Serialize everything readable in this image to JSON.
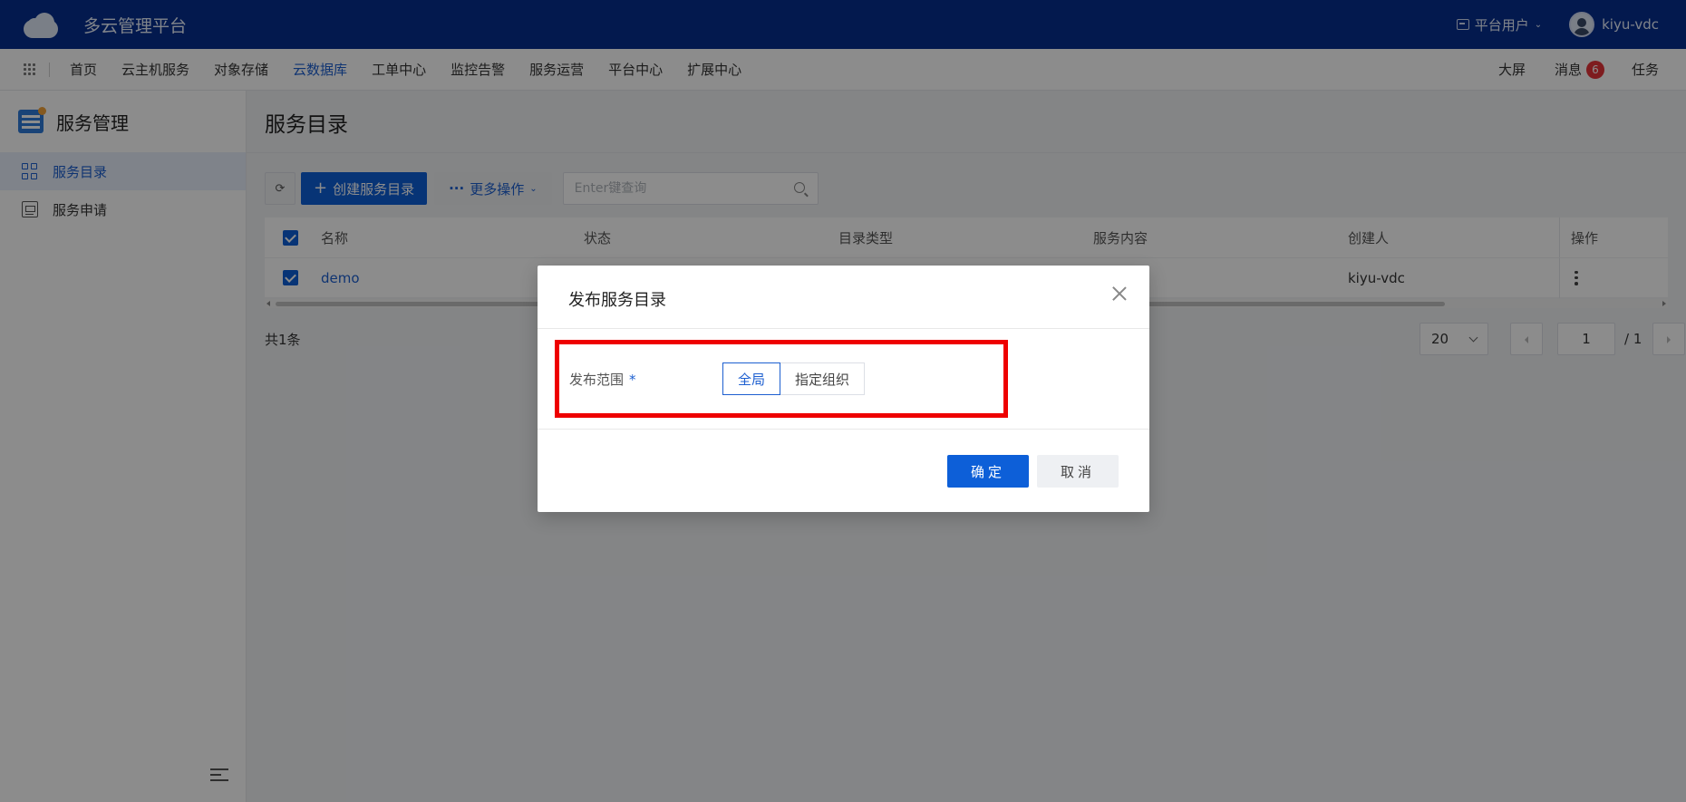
{
  "app": {
    "title": "多云管理平台"
  },
  "topbar": {
    "role": "平台用户",
    "username": "kiyu-vdc"
  },
  "nav": {
    "items": [
      "首页",
      "云主机服务",
      "对象存储",
      "云数据库",
      "工单中心",
      "监控告警",
      "服务运营",
      "平台中心",
      "扩展中心"
    ],
    "active_index": 3,
    "right": {
      "screen": "大屏",
      "messages": "消息",
      "message_count": "6",
      "tasks": "任务"
    }
  },
  "sidebar": {
    "title": "服务管理",
    "items": [
      {
        "label": "服务目录",
        "active": true
      },
      {
        "label": "服务申请",
        "active": false
      }
    ]
  },
  "main": {
    "page_title": "服务目录",
    "toolbar": {
      "refresh_icon": "refresh-icon",
      "create_label": "创建服务目录",
      "more_label": "更多操作",
      "search_placeholder": "Enter键查询"
    },
    "table": {
      "columns": [
        "名称",
        "状态",
        "目录类型",
        "服务内容",
        "创建人",
        "操作"
      ],
      "rows": [
        {
          "name": "demo",
          "status": "",
          "type": "",
          "content": "",
          "creator": "kiyu-vdc",
          "checked": true
        }
      ]
    },
    "total": "共1条",
    "pager": {
      "page_size": "20",
      "current": "1",
      "total_pages": "/ 1"
    }
  },
  "modal": {
    "title": "发布服务目录",
    "field_label": "发布范围",
    "required_mark": "*",
    "options": [
      "全局",
      "指定组织"
    ],
    "selected": "全局",
    "ok_label": "确定",
    "cancel_label": "取消"
  }
}
